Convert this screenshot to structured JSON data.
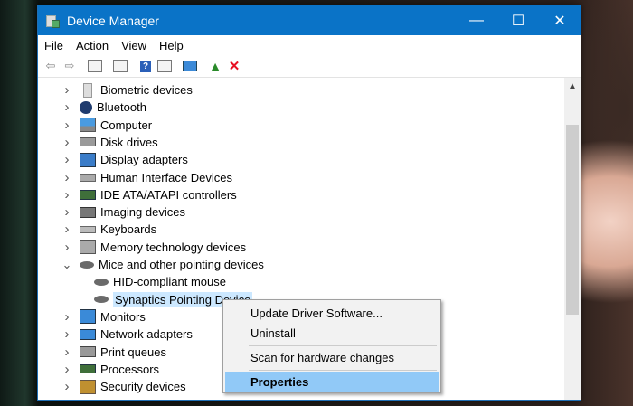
{
  "window": {
    "title": "Device Manager",
    "buttons": {
      "minimize": "—",
      "maximize": "☐",
      "close": "✕"
    }
  },
  "menu": [
    "File",
    "Action",
    "View",
    "Help"
  ],
  "toolbar": [
    "back-icon",
    "forward-icon",
    "properties-icon",
    "details-icon",
    "help-icon",
    "view-icon",
    "monitor-icon",
    "update-driver-icon",
    "uninstall-icon"
  ],
  "tree": [
    {
      "label": "Biometric devices",
      "icon": "biometric-icon",
      "expanded": false
    },
    {
      "label": "Bluetooth",
      "icon": "bluetooth-icon",
      "expanded": false
    },
    {
      "label": "Computer",
      "icon": "computer-icon",
      "expanded": false
    },
    {
      "label": "Disk drives",
      "icon": "disk-icon",
      "expanded": false
    },
    {
      "label": "Display adapters",
      "icon": "display-icon",
      "expanded": false
    },
    {
      "label": "Human Interface Devices",
      "icon": "hid-icon",
      "expanded": false
    },
    {
      "label": "IDE ATA/ATAPI controllers",
      "icon": "ide-icon",
      "expanded": false
    },
    {
      "label": "Imaging devices",
      "icon": "camera-icon",
      "expanded": false
    },
    {
      "label": "Keyboards",
      "icon": "keyboard-icon",
      "expanded": false
    },
    {
      "label": "Memory technology devices",
      "icon": "memory-icon",
      "expanded": false
    },
    {
      "label": "Mice and other pointing devices",
      "icon": "mouse-icon",
      "expanded": true
    },
    {
      "label": "HID-compliant mouse",
      "icon": "mouse-icon",
      "child": true
    },
    {
      "label": "Synaptics Pointing Device",
      "icon": "mouse-icon",
      "child": true,
      "selected": true
    },
    {
      "label": "Monitors",
      "icon": "monitor-icon",
      "expanded": false
    },
    {
      "label": "Network adapters",
      "icon": "network-icon",
      "expanded": false
    },
    {
      "label": "Print queues",
      "icon": "printer-icon",
      "expanded": false
    },
    {
      "label": "Processors",
      "icon": "processor-icon",
      "expanded": false
    },
    {
      "label": "Security devices",
      "icon": "security-icon",
      "expanded": false
    }
  ],
  "context_menu": [
    {
      "label": "Update Driver Software..."
    },
    {
      "label": "Uninstall"
    },
    {
      "label": "Scan for hardware changes"
    },
    {
      "label": "Properties",
      "highlighted": true
    }
  ],
  "colors": {
    "title_bar": "#0a73c7",
    "selection": "#cce8ff",
    "menu_highlight": "#91c9f7",
    "delete": "#e81123"
  }
}
